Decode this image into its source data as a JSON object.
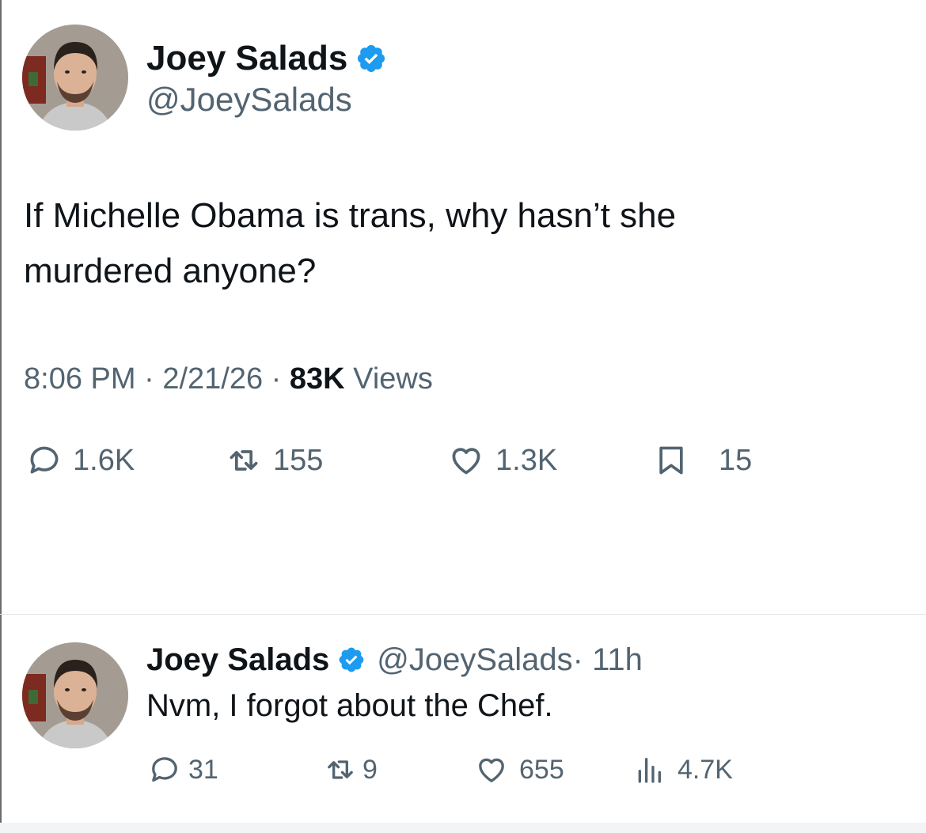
{
  "main_tweet": {
    "author": {
      "name": "Joey Salads",
      "handle": "@JoeySalads",
      "verified": true
    },
    "text_line1": "If Michelle Obama is trans, why hasn’t she",
    "text_line2": "murdered anyone?",
    "time": "8:06 PM",
    "sep1": " · ",
    "date": "2/21/26",
    "sep2": " · ",
    "views_count": "83K",
    "views_label": " Views",
    "stats": {
      "replies": "1.6K",
      "reposts": "155",
      "likes": "1.3K",
      "bookmarks": "15"
    }
  },
  "reply_tweet": {
    "author": {
      "name": "Joey Salads",
      "handle": "@JoeySalads",
      "verified": true
    },
    "time_ago": " · 11h",
    "text": "Nvm, I forgot about the Chef.",
    "stats": {
      "replies": "31",
      "reposts": "9",
      "likes": "655",
      "views": "4.7K"
    }
  },
  "icons": {
    "verified": "verified-badge-icon",
    "reply": "reply-icon",
    "repost": "repost-icon",
    "like": "heart-icon",
    "bookmark": "bookmark-icon",
    "views": "views-chart-icon"
  },
  "colors": {
    "verified": "#1d9bf0",
    "text": "#0f1419",
    "secondary": "#536471"
  }
}
